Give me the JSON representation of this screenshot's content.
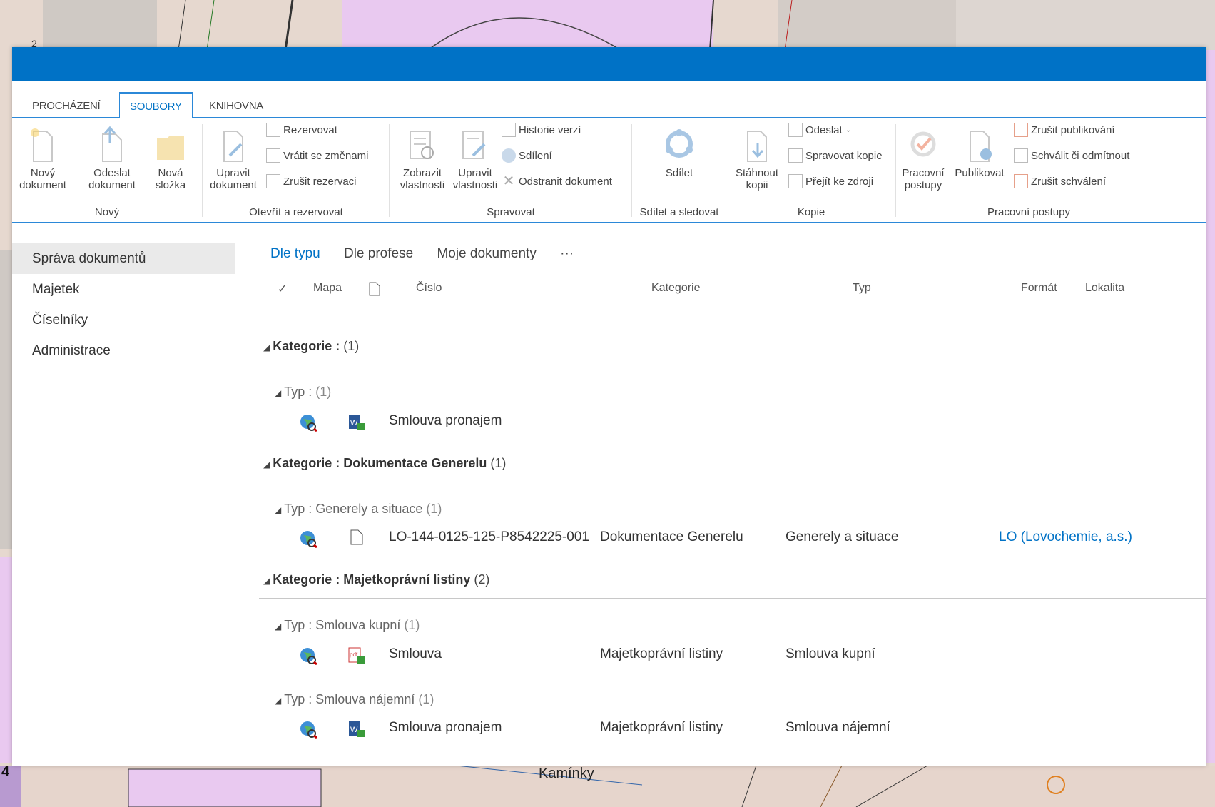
{
  "map": {
    "label": "Kamínky",
    "edge_number": "4",
    "corner_number": "2"
  },
  "ribbon": {
    "tabs": [
      "PROCHÁZENÍ",
      "SOUBORY",
      "KNIHOVNA"
    ],
    "groups": {
      "novy": {
        "label": "Nový",
        "new_doc": "Nový\ndokument",
        "upload": "Odeslat\ndokument",
        "folder": "Nová\nsložka"
      },
      "otevrit": {
        "label": "Otevřít a rezervovat",
        "edit": "Upravit\ndokument",
        "checkout": "Rezervovat",
        "checkin": "Vrátit se změnami",
        "discard": "Zrušit rezervaci"
      },
      "spravovat": {
        "label": "Spravovat",
        "view_props": "Zobrazit\nvlastnosti",
        "edit_props": "Upravit\nvlastnosti",
        "history": "Historie verzí",
        "sharing": "Sdílení",
        "delete": "Odstranit dokument"
      },
      "sdilet": {
        "label": "Sdílet a sledovat",
        "share": "Sdílet"
      },
      "kopie": {
        "label": "Kopie",
        "download": "Stáhnout\nkopii",
        "send": "Odeslat",
        "manage_copies": "Spravovat kopie",
        "go_source": "Přejít ke zdroji"
      },
      "workflow": {
        "label": "Pracovní postupy",
        "workflows": "Pracovní\npostupy",
        "publish": "Publikovat",
        "unpublish": "Zrušit publikování",
        "approve": "Schválit či odmítnout",
        "cancel_approval": "Zrušit schválení"
      }
    }
  },
  "leftnav": [
    "Správa dokumentů",
    "Majetek",
    "Číselníky",
    "Administrace"
  ],
  "views": [
    "Dle typu",
    "Dle profese",
    "Moje dokumenty",
    "···"
  ],
  "columns": {
    "check": "✓",
    "map": "Mapa",
    "cislo": "Číslo",
    "kategorie": "Kategorie",
    "typ": "Typ",
    "format": "Formát",
    "lokalita": "Lokalita"
  },
  "groups": [
    {
      "cat_label": "Kategorie :",
      "cat_value": "",
      "cat_count": "(1)",
      "sub_label": "Typ :",
      "sub_value": "",
      "sub_count": "(1)",
      "rows": [
        {
          "filetype": "word",
          "cislo": "Smlouva pronajem",
          "kategorie": "",
          "typ": "",
          "lokalita": ""
        }
      ]
    },
    {
      "cat_label": "Kategorie :",
      "cat_value": "Dokumentace Generelu",
      "cat_count": "(1)",
      "sub_label": "Typ :",
      "sub_value": "Generely a situace",
      "sub_count": "(1)",
      "rows": [
        {
          "filetype": "generic",
          "cislo": "LO-144-0125-125-P8542225-001",
          "kategorie": "Dokumentace Generelu",
          "typ": "Generely a situace",
          "lokalita": "LO (Lovochemie, a.s.)"
        }
      ]
    },
    {
      "cat_label": "Kategorie :",
      "cat_value": "Majetkoprávní listiny",
      "cat_count": "(2)",
      "sub_label": "Typ :",
      "sub_value": "Smlouva kupní",
      "sub_count": "(1)",
      "rows": [
        {
          "filetype": "pdf",
          "cislo": "Smlouva",
          "kategorie": "Majetkoprávní listiny",
          "typ": "Smlouva kupní",
          "lokalita": ""
        }
      ],
      "sub2_label": "Typ :",
      "sub2_value": "Smlouva nájemní",
      "sub2_count": "(1)",
      "rows2": [
        {
          "filetype": "word",
          "cislo": "Smlouva pronajem",
          "kategorie": "Majetkoprávní listiny",
          "typ": "Smlouva nájemní",
          "lokalita": ""
        }
      ]
    }
  ],
  "colors": {
    "accent": "#0072c6",
    "map_purple": "#e9c9f0",
    "map_beige": "#e6d5cc",
    "map_gray": "#cfcac6"
  }
}
